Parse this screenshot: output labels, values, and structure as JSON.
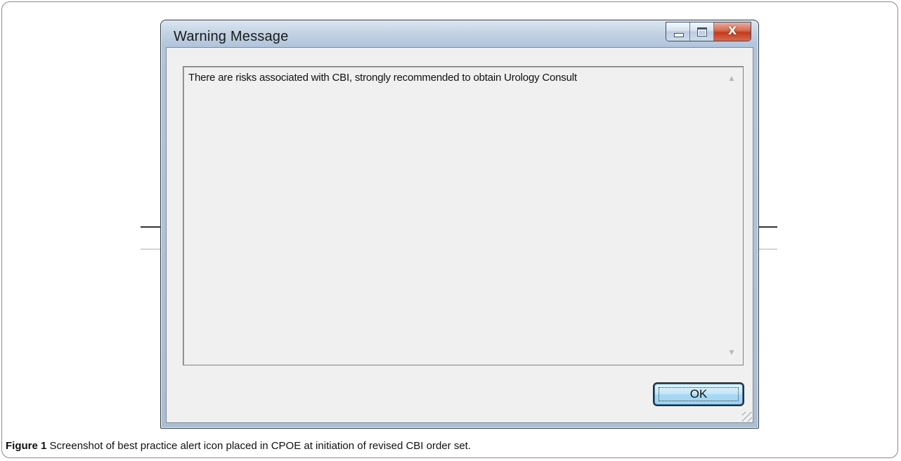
{
  "window": {
    "title": "Warning Message",
    "close_glyph": "X"
  },
  "message": {
    "text": "There are risks associated with CBI, strongly recommended to obtain Urology Consult"
  },
  "buttons": {
    "ok_label": "OK"
  },
  "figure": {
    "label": "Figure 1",
    "caption": "Screenshot of best practice alert icon placed in CPOE at initiation of revised CBI order set."
  },
  "icons": {
    "minimize": "minimize-icon",
    "maximize": "maximize-icon",
    "close": "close-icon",
    "scroll_up": "scroll-up-arrow-icon",
    "scroll_down": "scroll-down-arrow-icon",
    "resize_grip": "resize-grip-icon"
  },
  "colors": {
    "ok_button_fill": "#bfe5f7",
    "close_button_fill": "#c33a1d",
    "titlebar": "#c3d3e4"
  }
}
